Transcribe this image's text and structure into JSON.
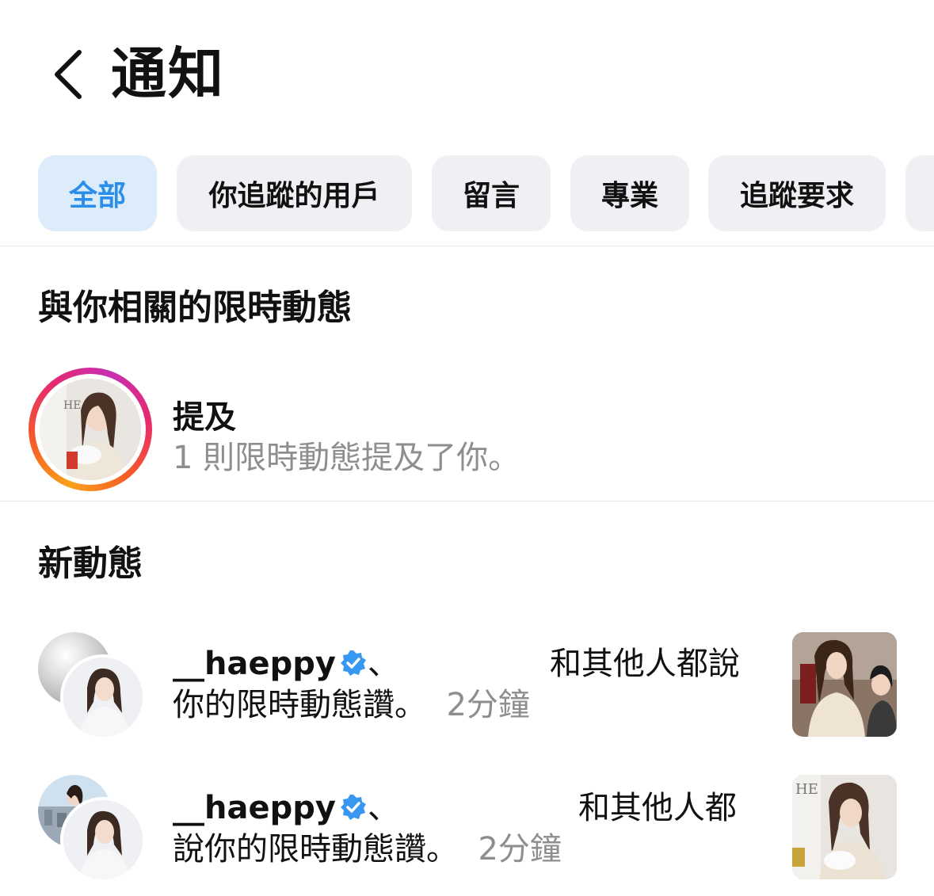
{
  "header": {
    "title": "通知"
  },
  "tabs": [
    {
      "label": "全部",
      "active": true
    },
    {
      "label": "你追蹤的用戶",
      "active": false
    },
    {
      "label": "留言",
      "active": false
    },
    {
      "label": "專業",
      "active": false
    },
    {
      "label": "追蹤要求",
      "active": false
    }
  ],
  "stories_section": {
    "title": "與你相關的限時動態",
    "mention": {
      "title": "提及",
      "subtitle": "1 則限時動態提及了你。",
      "thumb_text": "HE"
    }
  },
  "new_section": {
    "title": "新動態",
    "items": [
      {
        "username": "__haeppy",
        "separator": "、",
        "line1_rest": "和其他人都說",
        "line2_text": "你的限時動態讚。",
        "time": "2分鐘"
      },
      {
        "username": "__haeppy",
        "separator": "、",
        "line1_rest": "和其他人都",
        "line2_text": "說你的限時動態讚。",
        "time": "2分鐘",
        "thumb_text": "HE"
      }
    ]
  },
  "colors": {
    "active_tab_bg": "#dcecfb",
    "active_tab_text": "#2b8ee8",
    "verified_blue": "#3897f0",
    "secondary_text": "#8e8e8e"
  }
}
